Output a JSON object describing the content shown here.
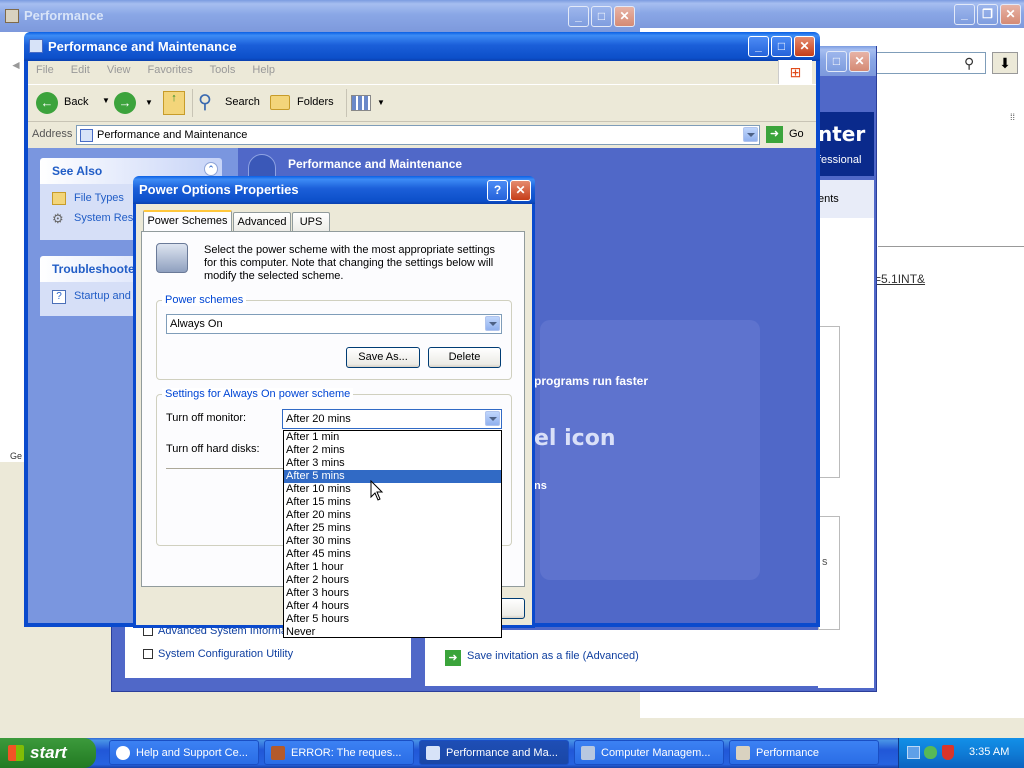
{
  "desktop": {
    "bg_window_title": "Performance",
    "bg_window_status": "Ge",
    "help_center": {
      "title_fragment": "nter",
      "subtitle_fragment": "fessional",
      "link_fragment": "ents",
      "url_fragment": "=5.1INT&",
      "side_text_fragment": "s",
      "save_link": "Save invitation as a file (Advanced)",
      "list_items": [
        "Advanced System Informa",
        "System Configuration Utility"
      ]
    }
  },
  "explorer": {
    "title": "Performance and Maintenance",
    "menu": [
      "File",
      "Edit",
      "View",
      "Favorites",
      "Tools",
      "Help"
    ],
    "toolbar": {
      "back": "Back",
      "search": "Search",
      "folders": "Folders"
    },
    "address_label": "Address",
    "address_value": "Performance and Maintenance",
    "go_label": "Go",
    "see_also": {
      "title": "See Also",
      "items": [
        "File Types",
        "System Res"
      ]
    },
    "troubleshooters": {
      "title": "Troubleshoote",
      "items": [
        "Startup and"
      ]
    },
    "content": {
      "header": "Performance and Maintenance",
      "text1": "programs run faster",
      "text2": "el icon",
      "text3": "ns"
    }
  },
  "dialog": {
    "title": "Power Options Properties",
    "tabs": [
      "Power Schemes",
      "Advanced",
      "UPS"
    ],
    "description": "Select the power scheme with the most appropriate settings for this computer. Note that changing the settings below will modify the selected scheme.",
    "schemes_group": "Power schemes",
    "scheme_value": "Always On",
    "save_as": "Save As...",
    "delete": "Delete",
    "settings_group": "Settings for Always On power scheme",
    "monitor_label": "Turn off monitor:",
    "monitor_value": "After 20 mins",
    "harddisk_label": "Turn off hard disks:",
    "dropdown_options": [
      "After 1 min",
      "After 2 mins",
      "After 3 mins",
      "After 5 mins",
      "After 10 mins",
      "After 15 mins",
      "After 20 mins",
      "After 25 mins",
      "After 30 mins",
      "After 45 mins",
      "After 1 hour",
      "After 2 hours",
      "After 3 hours",
      "After 4 hours",
      "After 5 hours",
      "Never"
    ],
    "highlighted_option": "After 5 mins"
  },
  "taskbar": {
    "start": "start",
    "buttons": [
      "Help and Support Ce...",
      "ERROR: The reques...",
      "Performance and Ma...",
      "Computer Managem...",
      "Performance"
    ],
    "clock": "3:35 AM"
  }
}
